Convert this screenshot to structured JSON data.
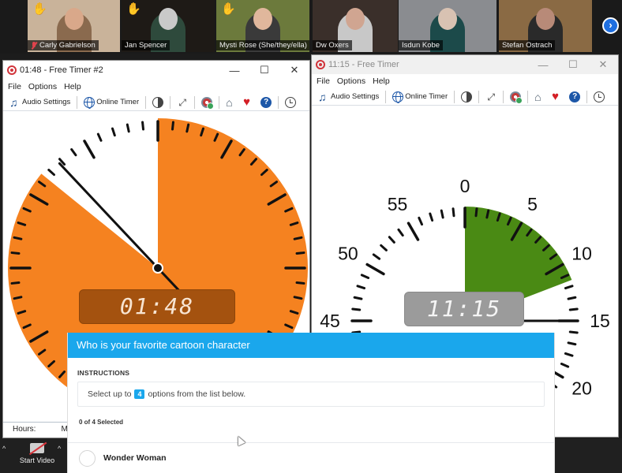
{
  "gallery": {
    "participants": [
      {
        "name": "Carly Gabrielson",
        "hand_raised": true,
        "muted": true,
        "bg": "#c9b39a",
        "shirt": "#8a6a4e",
        "skin": "#d9a88a"
      },
      {
        "name": "Jan Spencer",
        "hand_raised": true,
        "muted": false,
        "bg": "#1e1a16",
        "shirt": "#2e4a3c",
        "skin": "#c9c9c9"
      },
      {
        "name": "Mysti Rose (She/they/ella)",
        "hand_raised": true,
        "muted": false,
        "bg": "#6c7a3c",
        "shirt": "#3a3a3a",
        "skin": "#e0b79c",
        "active": true
      },
      {
        "name": "Dw Oxers",
        "hand_raised": false,
        "muted": false,
        "bg": "#3a2f2a",
        "shirt": "#c8c8c8",
        "skin": "#d0a591"
      },
      {
        "name": "Isdun Kobe",
        "hand_raised": false,
        "muted": false,
        "bg": "#8a8c90",
        "shirt": "#1c4a4a",
        "skin": "#d8c2b2"
      },
      {
        "name": "Stefan Ostrach",
        "hand_raised": false,
        "muted": false,
        "bg": "#8a6a44",
        "shirt": "#2a2a2a",
        "skin": "#b88a78"
      }
    ],
    "next_icon": "chevron-right-icon",
    "hand_icon": "✋"
  },
  "timer_left": {
    "title": "01:48 - Free Timer #2",
    "menu": [
      "File",
      "Options",
      "Help"
    ],
    "toolbar": {
      "audio_settings": "Audio Settings",
      "online_timer": "Online Timer"
    },
    "display": "01:48",
    "face_color": "#f58220",
    "led_color": "#a4520f",
    "remaining_minutes_on_dial": 51.5,
    "elapsed_gap_start_minutes": 51.5,
    "hand_minutes": 52.8,
    "bottom_label_hours": "Hours:",
    "bottom_label_minutes": "M"
  },
  "timer_right": {
    "title": "11:15 - Free Timer",
    "menu": [
      "File",
      "Options",
      "Help"
    ],
    "toolbar": {
      "audio_settings": "Audio Settings",
      "online_timer": "Online Timer"
    },
    "display": "11:15",
    "wedge_color": "#4a8a14",
    "wedge_end_minutes": 11.5,
    "hand_minutes": 15,
    "dial_labels": [
      "0",
      "5",
      "10",
      "15",
      "20",
      "45",
      "50",
      "55"
    ]
  },
  "window_buttons": {
    "minimize": "—",
    "maximize": "☐",
    "close": "✕"
  },
  "poll": {
    "question": "Who is your favorite cartoon character",
    "instructions_label": "INSTRUCTIONS",
    "instructions_pre": "Select up to",
    "max_selections": "4",
    "instructions_post": "options from the list below.",
    "selected_count": "0 of 4 Selected",
    "options": [
      {
        "label": "Wonder Woman",
        "selected": false
      }
    ]
  },
  "zoom_bar": {
    "start_video": "Start Video",
    "caret": "^"
  }
}
